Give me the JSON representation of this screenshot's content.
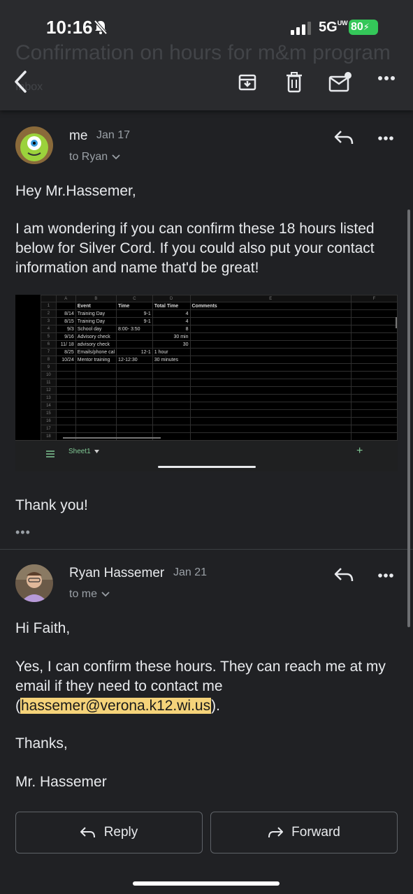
{
  "status_bar": {
    "time": "10:16",
    "network": "5G",
    "network_suffix": "UW",
    "battery": "80"
  },
  "subject": {
    "text": "Confirmation on hours for m&m program",
    "label": "Inbox"
  },
  "toolbar": {
    "back_icon": "arrow-left-icon",
    "archive_icon": "archive-icon",
    "delete_icon": "trash-icon",
    "unread_icon": "mark-unread-icon",
    "more_icon": "more-horizontal-icon"
  },
  "messages": [
    {
      "sender": "me",
      "date": "Jan 17",
      "recipient": "to Ryan",
      "paragraphs": [
        "Hey Mr.Hassemer,",
        "I am wondering if you can confirm these 18 hours listed below for Silver Cord. If you could also put your contact information and name that'd be great!"
      ],
      "closing": "Thank you!",
      "attachment": {
        "columns": [
          "A",
          "B",
          "C",
          "D",
          "E",
          "F"
        ],
        "header_row": [
          "",
          "Event",
          "Time",
          "Total Time",
          "Comments"
        ],
        "rows": [
          [
            "8/14",
            "Training Day",
            "9-1",
            "4",
            ""
          ],
          [
            "8/15",
            "Training Day",
            "9-1",
            "4",
            ""
          ],
          [
            "9/3",
            "School day",
            "8:00- 3:50",
            "8",
            ""
          ],
          [
            "9/16",
            "Advisory check",
            "",
            "30 min",
            ""
          ],
          [
            "11/ 18",
            "advisory check",
            "",
            "30",
            ""
          ],
          [
            "8/25",
            "Emails/phone cal",
            "12-1",
            "1 hour",
            ""
          ],
          [
            "10/24",
            "Mentor training",
            "12-12:30",
            "30 minutes",
            ""
          ]
        ],
        "row_numbers": [
          "1",
          "2",
          "3",
          "4",
          "5",
          "6",
          "7",
          "8",
          "9",
          "10",
          "11",
          "12",
          "13",
          "14",
          "15",
          "16",
          "17",
          "18"
        ],
        "sheet_tab": "Sheet1",
        "add_sheet": "+"
      }
    },
    {
      "sender": "Ryan Hassemer",
      "date": "Jan 21",
      "recipient": "to me",
      "greeting": "Hi Faith,",
      "body_before_link": "Yes, I can confirm these hours. They can reach me at my email if they need to contact me (",
      "link": "hassemer@verona.k12.wi.us",
      "body_after_link": ").",
      "signoff": "Thanks,",
      "signature": "Mr. Hassemer"
    }
  ],
  "actions": {
    "reply": "Reply",
    "forward": "Forward"
  },
  "colors": {
    "background": "#202124",
    "toolbar": "#2a2b2e",
    "link_highlight": "#f5d37a",
    "battery": "#34c759"
  }
}
